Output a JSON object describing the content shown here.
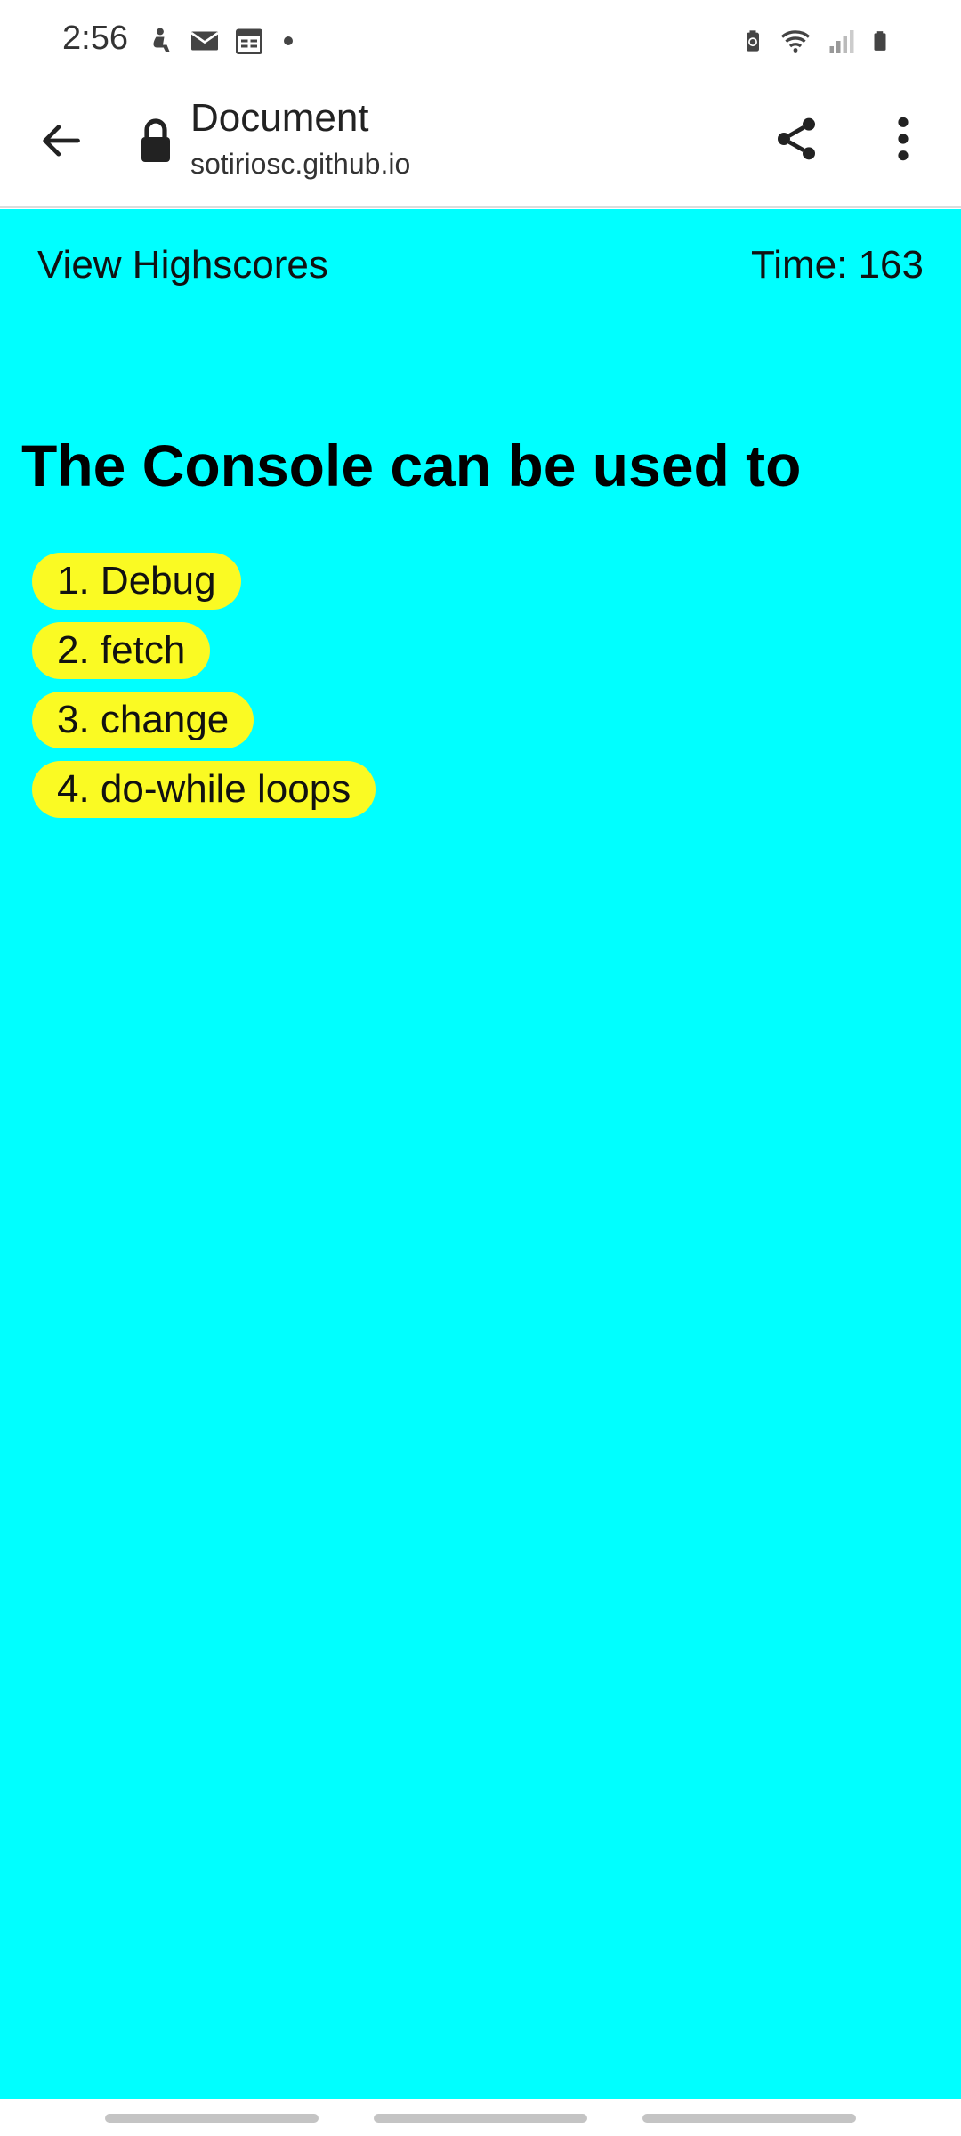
{
  "status_bar": {
    "time": "2:56",
    "left_icons": [
      "accessibility-icon",
      "mail-icon",
      "calendar-icon",
      "notification-dot-icon"
    ],
    "right_icons": [
      "battery-saver-icon",
      "wifi-icon",
      "signal-icon",
      "battery-icon"
    ]
  },
  "browser": {
    "title": "Document",
    "url": "sotiriosc.github.io",
    "back_icon": "arrow-left-icon",
    "lock_icon": "lock-icon",
    "share_icon": "share-icon",
    "menu_icon": "more-vert-icon"
  },
  "quiz": {
    "view_highscores": "View Highscores",
    "timer": "Time: 163",
    "question": "The Console can be used to",
    "answers": [
      "1. Debug",
      "2. fetch",
      "3. change",
      "4. do-while loops"
    ]
  },
  "colors": {
    "page_background": "#00ffff",
    "answer_background": "#fafa23"
  }
}
